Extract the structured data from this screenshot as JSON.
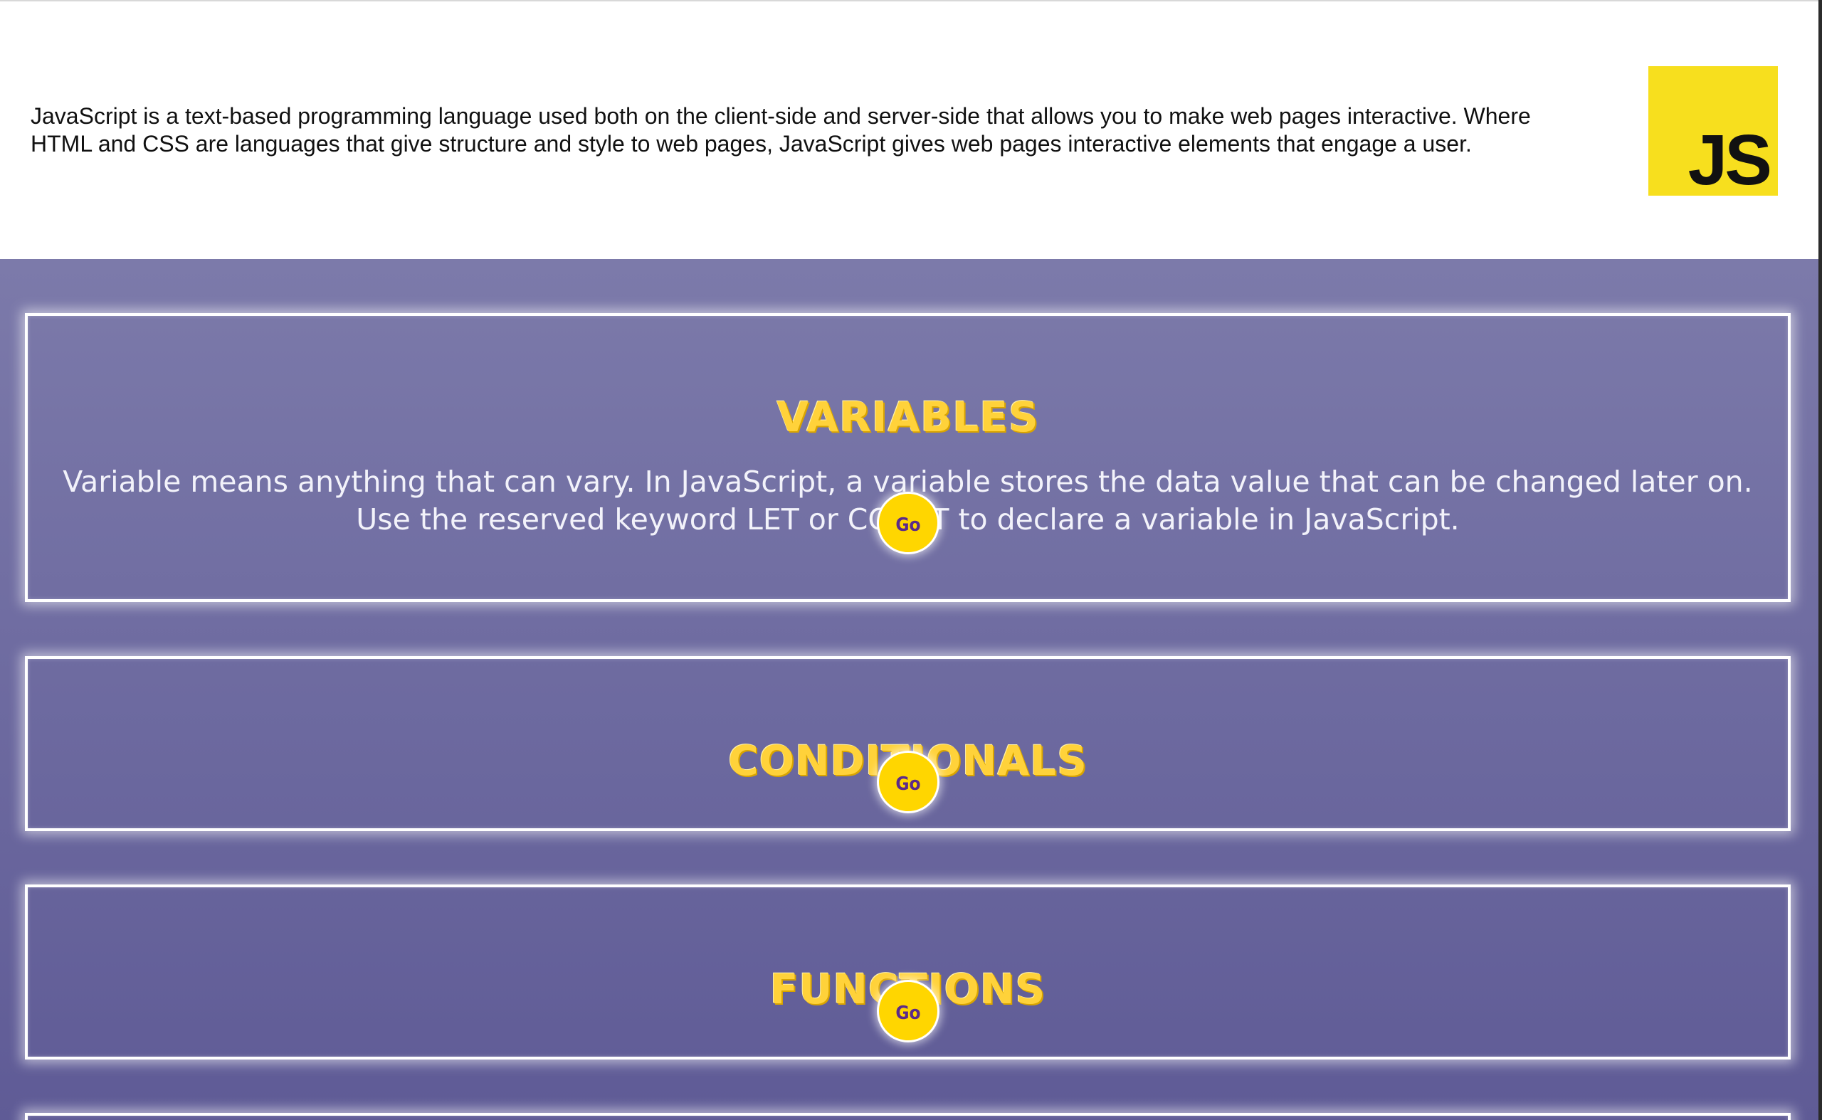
{
  "intro": {
    "text": "JavaScript is a text-based programming language used both on the client-side and server-side that allows you to make web pages interactive. Where HTML and CSS are languages that give structure and style to web pages, JavaScript gives web pages interactive elements that engage a user.",
    "logo_text": "JS"
  },
  "sections": [
    {
      "title": "VARIABLES",
      "description": "Variable means anything that can vary. In JavaScript, a variable stores the data value that can be changed later on. Use the reserved keyword LET or CONST to declare a variable in JavaScript.",
      "button_label": "Go"
    },
    {
      "title": "CONDITIONALS",
      "button_label": "Go"
    },
    {
      "title": "FUNCTIONS",
      "button_label": "Go"
    }
  ],
  "colors": {
    "accent": "#ffd600",
    "background_top": "#7c7aaa",
    "background_bottom": "#5f5b96",
    "logo": "#f7df1e"
  }
}
